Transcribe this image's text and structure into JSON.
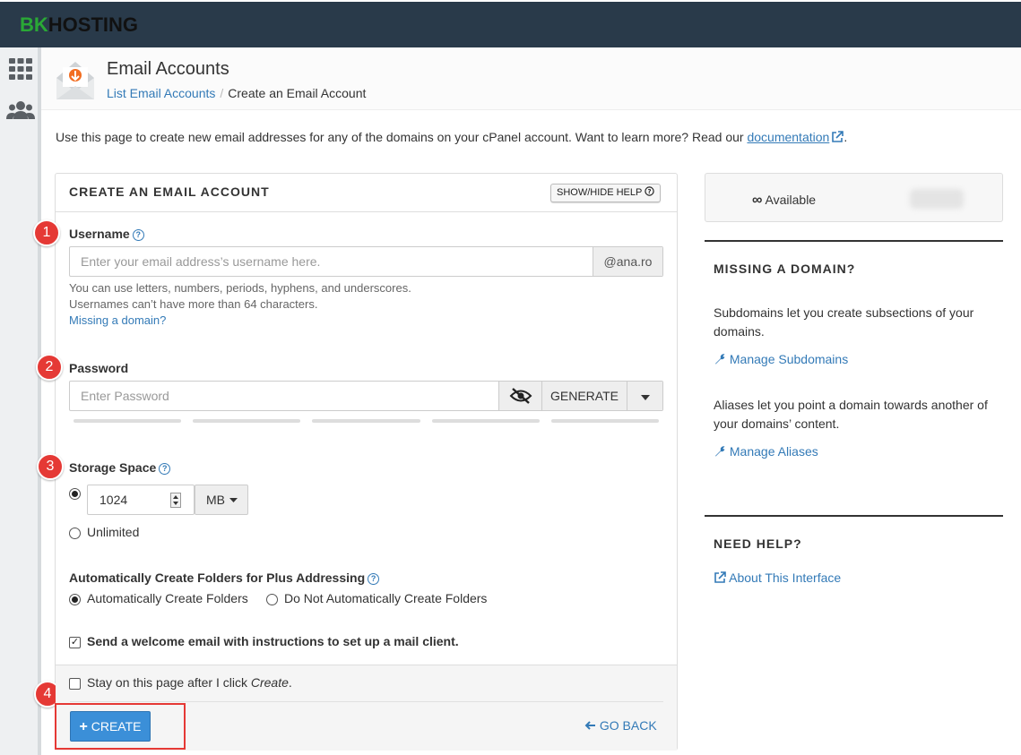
{
  "brand": {
    "part1": "BK",
    "part2": "HOSTING"
  },
  "header": {
    "title": "Email Accounts",
    "breadcrumb_link": "List Email Accounts",
    "breadcrumb_current": "Create an Email Account"
  },
  "intro": {
    "text": "Use this page to create new email addresses for any of the domains on your cPanel account. Want to learn more? Read our",
    "link": "documentation",
    "end": "."
  },
  "form": {
    "title": "CREATE AN EMAIL ACCOUNT",
    "help_btn": "SHOW/HIDE HELP",
    "username": {
      "label": "Username",
      "placeholder": "Enter your email address’s username here.",
      "domain": "@ana.ro",
      "hint1": "You can use letters, numbers, periods, hyphens, and underscores.",
      "hint2": "Usernames can’t have more than 64 characters.",
      "missing": "Missing a domain?"
    },
    "password": {
      "label": "Password",
      "placeholder": "Enter Password",
      "generate": "GENERATE"
    },
    "storage": {
      "label": "Storage Space",
      "value": "1024",
      "unit": "MB",
      "unlimited": "Unlimited"
    },
    "plus": {
      "label": "Automatically Create Folders for Plus Addressing",
      "opt1": "Automatically Create Folders",
      "opt2": "Do Not Automatically Create Folders"
    },
    "welcome": "Send a welcome email with instructions to set up a mail client.",
    "stay_pre": "Stay on this page after I click ",
    "stay_em": "Create",
    "stay_post": ".",
    "create": "CREATE",
    "goback": "GO BACK"
  },
  "steps": [
    "1",
    "2",
    "3",
    "4"
  ],
  "sidebar": {
    "available": "Available",
    "missing_title": "MISSING A DOMAIN?",
    "sub_text": "Subdomains let you create subsections of your domains.",
    "sub_link": "Manage Subdomains",
    "alias_text": "Aliases let you point a domain towards another of your domains’ content.",
    "alias_link": "Manage Aliases",
    "help_title": "NEED HELP?",
    "help_link": "About This Interface"
  },
  "colors": {
    "topbar": "#293a4a",
    "brand_green": "#2aa836",
    "link": "#337ab7",
    "primary": "#3b8fd8",
    "step_badge": "#e53935"
  }
}
